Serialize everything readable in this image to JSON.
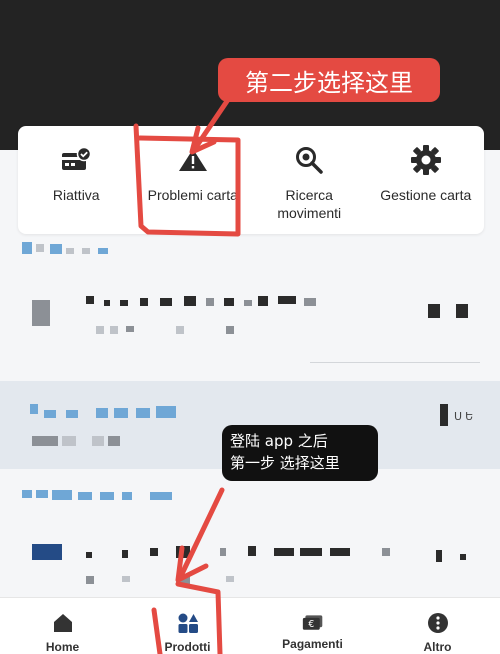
{
  "actions": [
    {
      "label": "Riattiva",
      "icon": "card-check-icon"
    },
    {
      "label": "Problemi carta",
      "icon": "warning-icon"
    },
    {
      "label": "Ricerca movimenti",
      "icon": "search-icon"
    },
    {
      "label": "Gestione carta",
      "icon": "gear-icon"
    }
  ],
  "bottom_nav": [
    {
      "label": "Home",
      "icon": "home-icon"
    },
    {
      "label": "Prodotti",
      "icon": "products-icon",
      "active": true
    },
    {
      "label": "Pagamenti",
      "icon": "euro-card-icon"
    },
    {
      "label": "Altro",
      "icon": "more-icon"
    }
  ],
  "annotations": {
    "step2": "第二步选择这里",
    "step1_line1": "登陆 app 之后",
    "step1_line2": "第一步 选择这里"
  },
  "amounts": {
    "blurred_amount": "Ս Ե"
  },
  "colors": {
    "header_bg": "#232323",
    "annotation_red": "#e44a42",
    "annotation_dark": "#111111",
    "accent_blue": "#244b86"
  }
}
